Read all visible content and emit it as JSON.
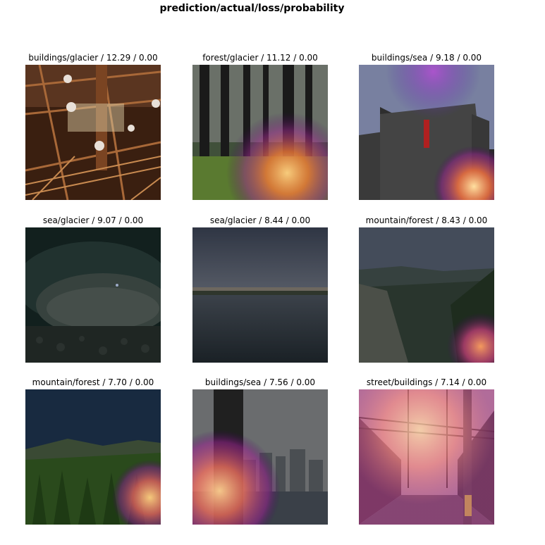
{
  "figure": {
    "title": "prediction/actual/loss/probability"
  },
  "panels": [
    {
      "label": "buildings/glacier / 12.29 / 0.00"
    },
    {
      "label": "forest/glacier / 11.12 / 0.00"
    },
    {
      "label": "buildings/sea / 9.18 / 0.00"
    },
    {
      "label": "sea/glacier / 9.07 / 0.00"
    },
    {
      "label": "sea/glacier / 8.44 / 0.00"
    },
    {
      "label": "mountain/forest / 8.43 / 0.00"
    },
    {
      "label": "mountain/forest / 7.70 / 0.00"
    },
    {
      "label": "buildings/sea / 7.56 / 0.00"
    },
    {
      "label": "street/buildings / 7.14 / 0.00"
    }
  ]
}
